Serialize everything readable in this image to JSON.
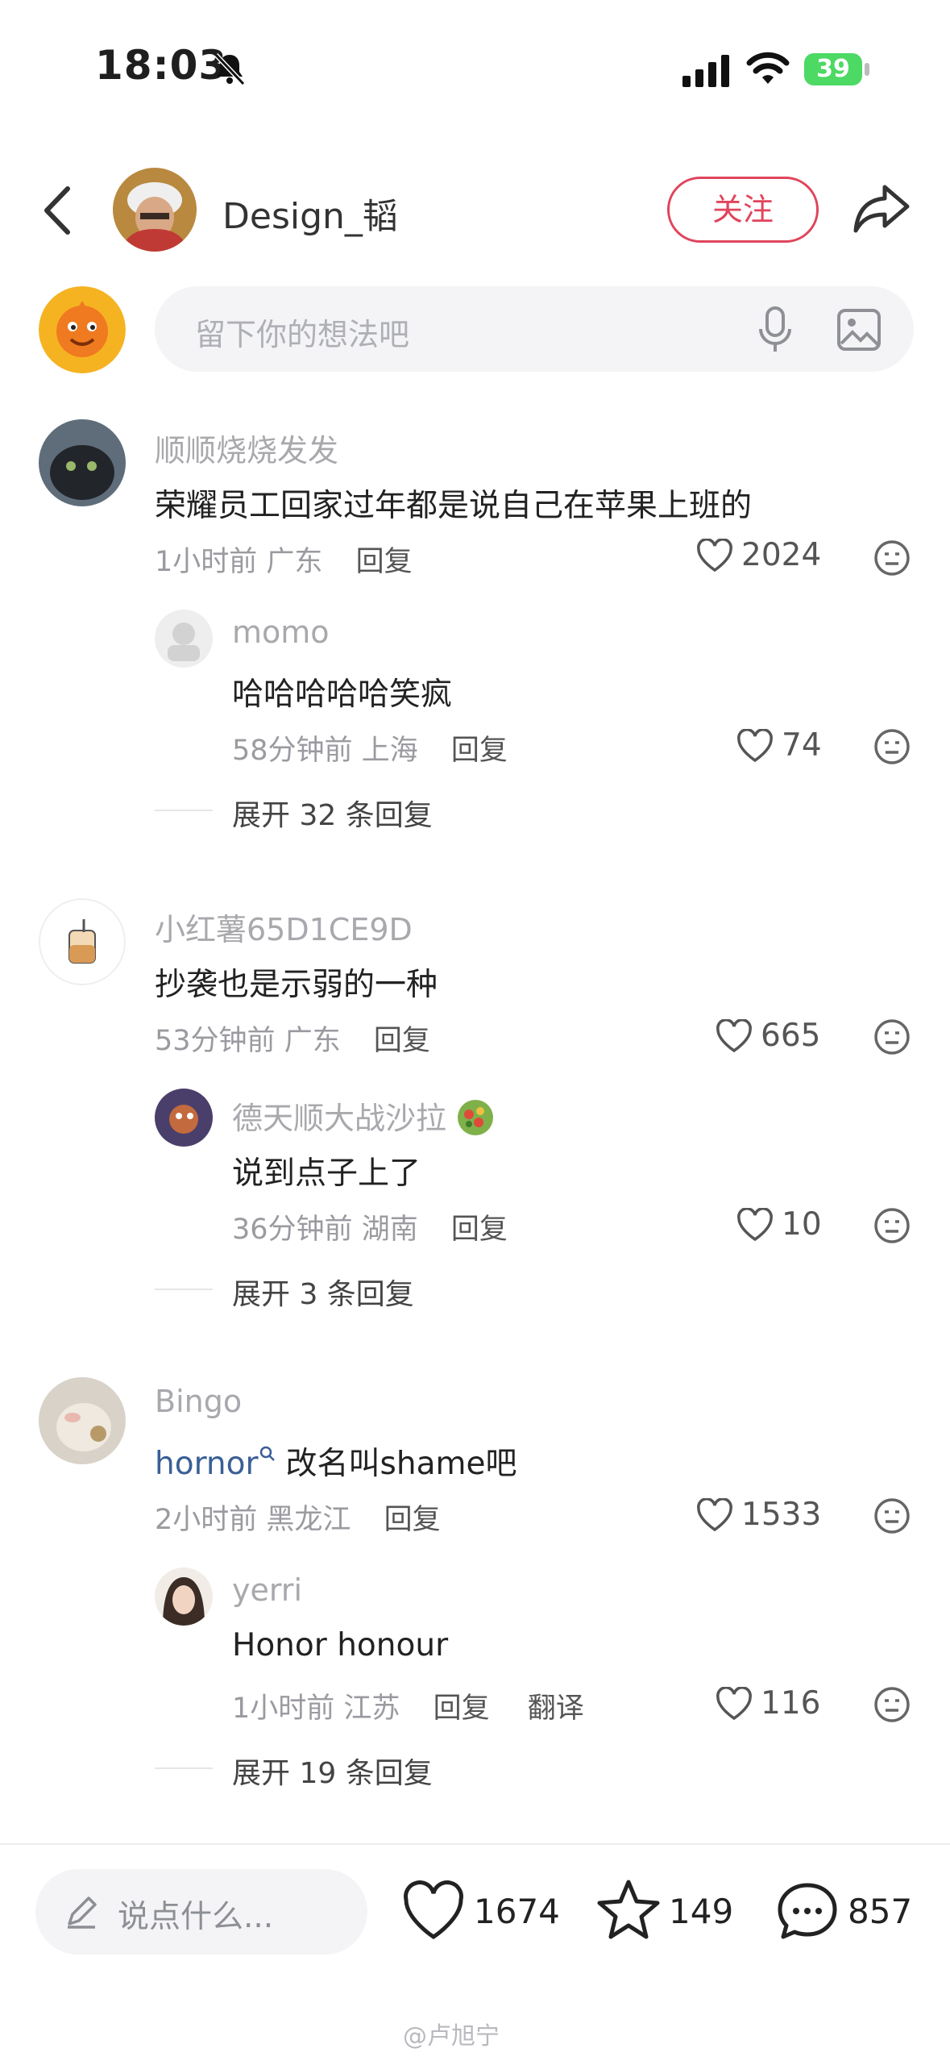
{
  "status_bar": {
    "time": "18:03",
    "battery": "39",
    "icons": [
      "bell-slash-icon",
      "signal-icon",
      "wifi-icon",
      "battery-charging-icon"
    ]
  },
  "header": {
    "host_name": "Design_韬",
    "follow_label": "关注",
    "icons": [
      "back-chevron-icon",
      "share-arrow-icon"
    ]
  },
  "composer": {
    "placeholder": "留下你的想法吧",
    "icons": [
      "microphone-icon",
      "image-icon"
    ]
  },
  "comments": [
    {
      "user": "顺顺烧烧发发",
      "text": "荣耀员工回家过年都是说自己在苹果上班的",
      "time": "1小时前",
      "location": "广东",
      "reply_label": "回复",
      "likes": "2024",
      "reply": {
        "user": "momo",
        "text": "哈哈哈哈哈笑疯",
        "time": "58分钟前",
        "location": "上海",
        "reply_label": "回复",
        "likes": "74"
      },
      "expand_label": "展开 32 条回复"
    },
    {
      "user": "小红薯65D1CE9D",
      "text": "抄袭也是示弱的一种",
      "time": "53分钟前",
      "location": "广东",
      "reply_label": "回复",
      "likes": "665",
      "reply": {
        "user": "德天顺大战沙拉",
        "text": "说到点子上了",
        "time": "36分钟前",
        "location": "湖南",
        "reply_label": "回复",
        "likes": "10"
      },
      "expand_label": "展开 3 条回复"
    },
    {
      "user": "Bingo",
      "keyword": "hornor",
      "text": "改名叫shame吧",
      "time": "2小时前",
      "location": "黑龙江",
      "reply_label": "回复",
      "likes": "1533",
      "reply": {
        "user": "yerri",
        "text": "Honor honour",
        "time": "1小时前",
        "location": "江苏",
        "reply_label": "回复",
        "translate_label": "翻译",
        "likes": "116"
      },
      "expand_label": "展开 19 条回复"
    }
  ],
  "bottom_bar": {
    "placeholder": "说点什么...",
    "likes": "1674",
    "stars": "149",
    "comments": "857"
  },
  "watermark": "@卢旭宁",
  "colors": {
    "accent": "#e0455c",
    "keyword": "#3a5f96"
  }
}
